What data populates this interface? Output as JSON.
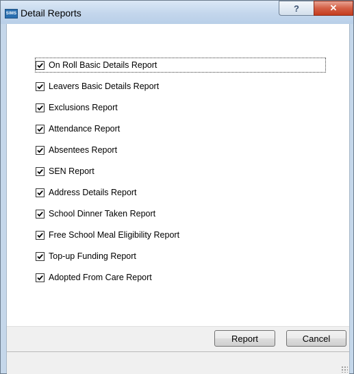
{
  "window": {
    "app_icon_text": "SIMS",
    "title": "Detail Reports",
    "help_label": "?",
    "close_label": "✕"
  },
  "reports": [
    {
      "label": "On Roll Basic Details Report",
      "checked": true
    },
    {
      "label": "Leavers Basic Details Report",
      "checked": true
    },
    {
      "label": "Exclusions Report",
      "checked": true
    },
    {
      "label": "Attendance Report",
      "checked": true
    },
    {
      "label": "Absentees Report",
      "checked": true
    },
    {
      "label": "SEN Report",
      "checked": true
    },
    {
      "label": "Address Details Report",
      "checked": true
    },
    {
      "label": "School Dinner Taken Report",
      "checked": true
    },
    {
      "label": "Free School Meal Eligibility Report",
      "checked": true
    },
    {
      "label": "Top-up Funding Report",
      "checked": true
    },
    {
      "label": "Adopted From Care Report",
      "checked": true
    }
  ],
  "buttons": {
    "report_label": "Report",
    "cancel_label": "Cancel"
  }
}
